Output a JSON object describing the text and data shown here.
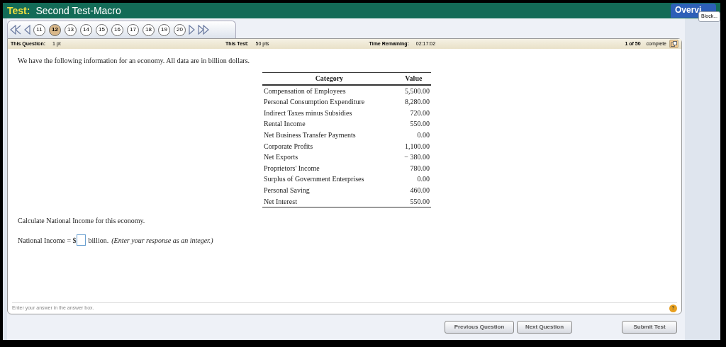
{
  "header": {
    "label": "Test:",
    "title": "Second Test-Macro",
    "overview_button": "Overvi",
    "tooltip": "Block..."
  },
  "nav": {
    "questions": [
      {
        "label": "11",
        "selected": false
      },
      {
        "label": "12",
        "selected": true
      },
      {
        "label": "13",
        "selected": false
      },
      {
        "label": "14",
        "selected": false
      },
      {
        "label": "15",
        "selected": false
      },
      {
        "label": "16",
        "selected": false
      },
      {
        "label": "17",
        "selected": false
      },
      {
        "label": "18",
        "selected": false
      },
      {
        "label": "19",
        "selected": false
      },
      {
        "label": "20",
        "selected": false
      }
    ]
  },
  "info": {
    "question_label": "This Question:",
    "question_value": "1 pt",
    "test_label": "This Test:",
    "test_value": "50 pts",
    "time_label": "Time Remaining:",
    "time_value": "02:17:02",
    "progress": "1 of 50",
    "progress_label": "complete"
  },
  "intro": "We have the following information for an economy. All data are in billion dollars.",
  "table": {
    "columns": [
      "Category",
      "Value"
    ],
    "rows": [
      [
        "Compensation of Employees",
        "5,500.00"
      ],
      [
        "Personal Consumption Expenditure",
        "8,280.00"
      ],
      [
        "Indirect Taxes minus Subsidies",
        "720.00"
      ],
      [
        "Rental Income",
        "550.00"
      ],
      [
        "Net Business Transfer Payments",
        "0.00"
      ],
      [
        "Corporate Profits",
        "1,100.00"
      ],
      [
        "Net Exports",
        "− 380.00"
      ],
      [
        "Proprietors' Income",
        "780.00"
      ],
      [
        "Surplus of Government Enterprises",
        "0.00"
      ],
      [
        "Personal Saving",
        "460.00"
      ],
      [
        "Net Interest",
        "550.00"
      ]
    ]
  },
  "question": "Calculate National Income for this economy.",
  "answer": {
    "prefix": "National Income = $",
    "suffix": "billion.",
    "hint": "(Enter your response as an integer.)"
  },
  "footer_hint": "Enter your answer in the answer box.",
  "help": "?",
  "buttons": [
    "Previous Question",
    "Next Question",
    "Submit Test"
  ]
}
